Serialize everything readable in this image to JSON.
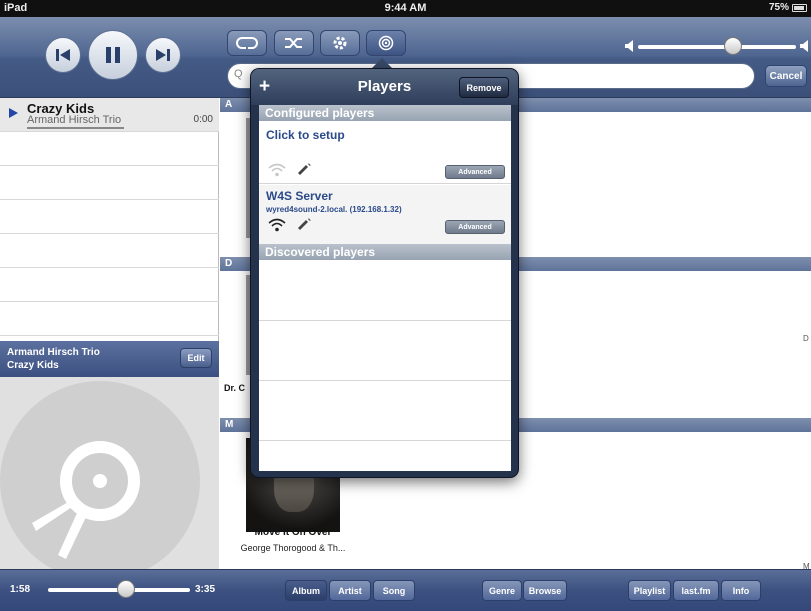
{
  "status_bar": {
    "device": "iPad",
    "time": "9:44 AM",
    "battery": "75%"
  },
  "toolbar": {
    "prev_icon": "skip-back-icon",
    "pause_icon": "pause-icon",
    "next_icon": "skip-forward-icon",
    "mode_buttons": [
      "repeat-icon",
      "shuffle-icon",
      "settings-gear-icon",
      "players-icon"
    ],
    "volume_level": 0.6
  },
  "search": {
    "placeholder": "",
    "cancel_label": "Cancel"
  },
  "playlist": {
    "items": [
      {
        "title": "Crazy Kids",
        "artist": "Armand Hirsch Trio",
        "time": "0:00"
      }
    ]
  },
  "now_playing": {
    "artist": "Armand Hirsch Trio",
    "track": "Crazy Kids",
    "edit_label": "Edit"
  },
  "content": {
    "sections": [
      "A",
      "D",
      "M"
    ],
    "partial_label": "Dr. C",
    "edge_letters": [
      "D",
      "M"
    ],
    "album": {
      "title": "Move It On Over",
      "artist": "George Thorogood & Th..."
    }
  },
  "players_popover": {
    "title": "Players",
    "add_label": "+",
    "remove_label": "Remove",
    "configured_header": "Configured players",
    "discovered_header": "Discovered players",
    "players": [
      {
        "name": "Click to setup",
        "host": "",
        "advanced_label": "Advanced"
      },
      {
        "name": "W4S Server",
        "host": "wyred4sound-2.local.   (192.168.1.32)",
        "advanced_label": "Advanced"
      }
    ]
  },
  "bottom_bar": {
    "elapsed": "1:58",
    "total": "3:35",
    "progress": 0.55,
    "browse_tabs": [
      "Album",
      "Artist",
      "Song"
    ],
    "selected_tab": "Album",
    "mid_tabs": [
      "Genre",
      "Browse"
    ],
    "right_tabs": [
      "Playlist",
      "last.fm",
      "Info"
    ]
  }
}
